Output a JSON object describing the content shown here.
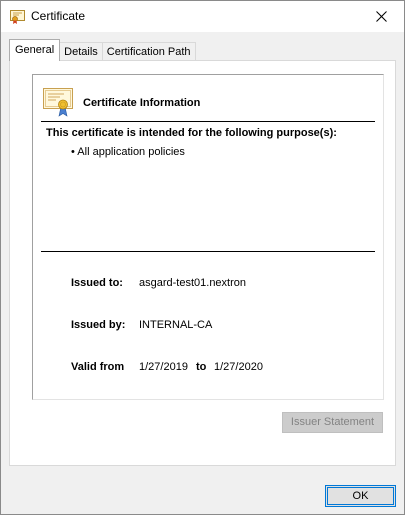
{
  "window": {
    "title": "Certificate",
    "close_glyph": "✕"
  },
  "tabs": [
    {
      "label": "General",
      "selected": true
    },
    {
      "label": "Details",
      "selected": false
    },
    {
      "label": "Certification Path",
      "selected": false
    }
  ],
  "general": {
    "info_title": "Certificate Information",
    "purpose_heading": "This certificate is intended for the following purpose(s):",
    "purposes": [
      "• All application policies"
    ],
    "issued_to_label": "Issued to:",
    "issued_to_value": "asgard-test01.nextron",
    "issued_by_label": "Issued by:",
    "issued_by_value": "INTERNAL-CA",
    "valid_from_label": "Valid from",
    "valid_from_value": "1/27/2019",
    "valid_to_label": "to",
    "valid_to_value": "1/27/2020",
    "issuer_statement_label": "Issuer Statement",
    "issuer_statement_enabled": false
  },
  "footer": {
    "ok_label": "OK"
  },
  "icons": {
    "title_icon": "certificate-icon",
    "info_icon": "certificate-ribbon-icon",
    "close_icon": "close-icon"
  },
  "colors": {
    "focus_border": "#0078d7",
    "disabled_button_bg": "#cccccc",
    "disabled_button_text": "#838383",
    "dialog_bg": "#f0f0f0"
  }
}
